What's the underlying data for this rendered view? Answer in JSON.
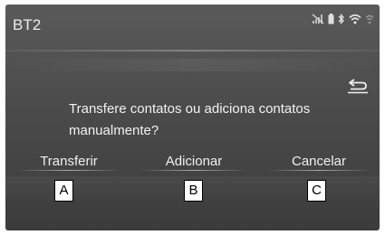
{
  "header": {
    "title": "BT2"
  },
  "status_icons": [
    "no-signal-icon",
    "battery-icon",
    "bluetooth-icon",
    "wifi-icon",
    "wifi-icon"
  ],
  "dialog": {
    "message": "Transfere contatos ou adiciona contatos manualmente?",
    "options": [
      {
        "label": "Transferir",
        "marker": "A"
      },
      {
        "label": "Adicionar",
        "marker": "B"
      },
      {
        "label": "Cancelar",
        "marker": "C"
      }
    ]
  },
  "colors": {
    "screen_bg": "#4e4e4e",
    "text": "#f2f2f2",
    "marker_bg": "#ffffff"
  }
}
